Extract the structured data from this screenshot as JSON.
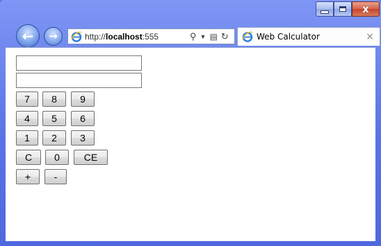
{
  "browser": {
    "address_prefix": "http://",
    "address_host": "localhost",
    "address_rest": ":555",
    "tab_title": "Web Calculator",
    "icons": {
      "back": "back-arrow-icon",
      "forward": "forward-arrow-icon",
      "search": "search-icon",
      "dropdown": "chevron-down-icon",
      "compat": "compatibility-view-icon",
      "refresh": "refresh-icon",
      "tab_close": "close-icon"
    },
    "caption": {
      "close_glyph": "x"
    }
  },
  "calculator": {
    "display1": "",
    "display2": "",
    "buttons": {
      "b7": "7",
      "b8": "8",
      "b9": "9",
      "b4": "4",
      "b5": "5",
      "b6": "6",
      "b1": "1",
      "b2": "2",
      "b3": "3",
      "clear": "C",
      "b0": "0",
      "clear_entry": "CE",
      "plus": "+",
      "minus": "-"
    }
  }
}
